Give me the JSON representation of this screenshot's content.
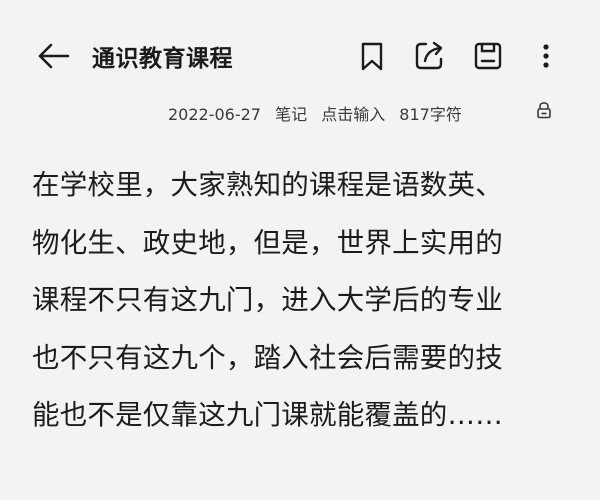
{
  "header": {
    "title": "通识教育课程",
    "back_icon": "arrow-left-icon",
    "actions": [
      {
        "name": "bookmark",
        "icon": "bookmark-icon"
      },
      {
        "name": "share",
        "icon": "share-icon"
      },
      {
        "name": "save",
        "icon": "save-icon"
      },
      {
        "name": "more",
        "icon": "more-vertical-icon"
      }
    ]
  },
  "meta": {
    "date": "2022-06-27",
    "category": "笔记",
    "input_hint": "点击输入",
    "char_count": "817字符",
    "lock_icon": "lock-icon"
  },
  "content": {
    "lines": [
      "在学校里，大家熟知的课程是语数英、",
      "物化生、政史地，但是，世界上实用的",
      "课程不只有这九门，进入大学后的专业",
      "也不只有这九个，踏入社会后需要的技",
      "能也不是仅靠这九门课就能覆盖的……"
    ]
  },
  "colors": {
    "background": "#f3f3f3",
    "text": "#1c1c1c",
    "meta_text": "#3a3a3a"
  }
}
